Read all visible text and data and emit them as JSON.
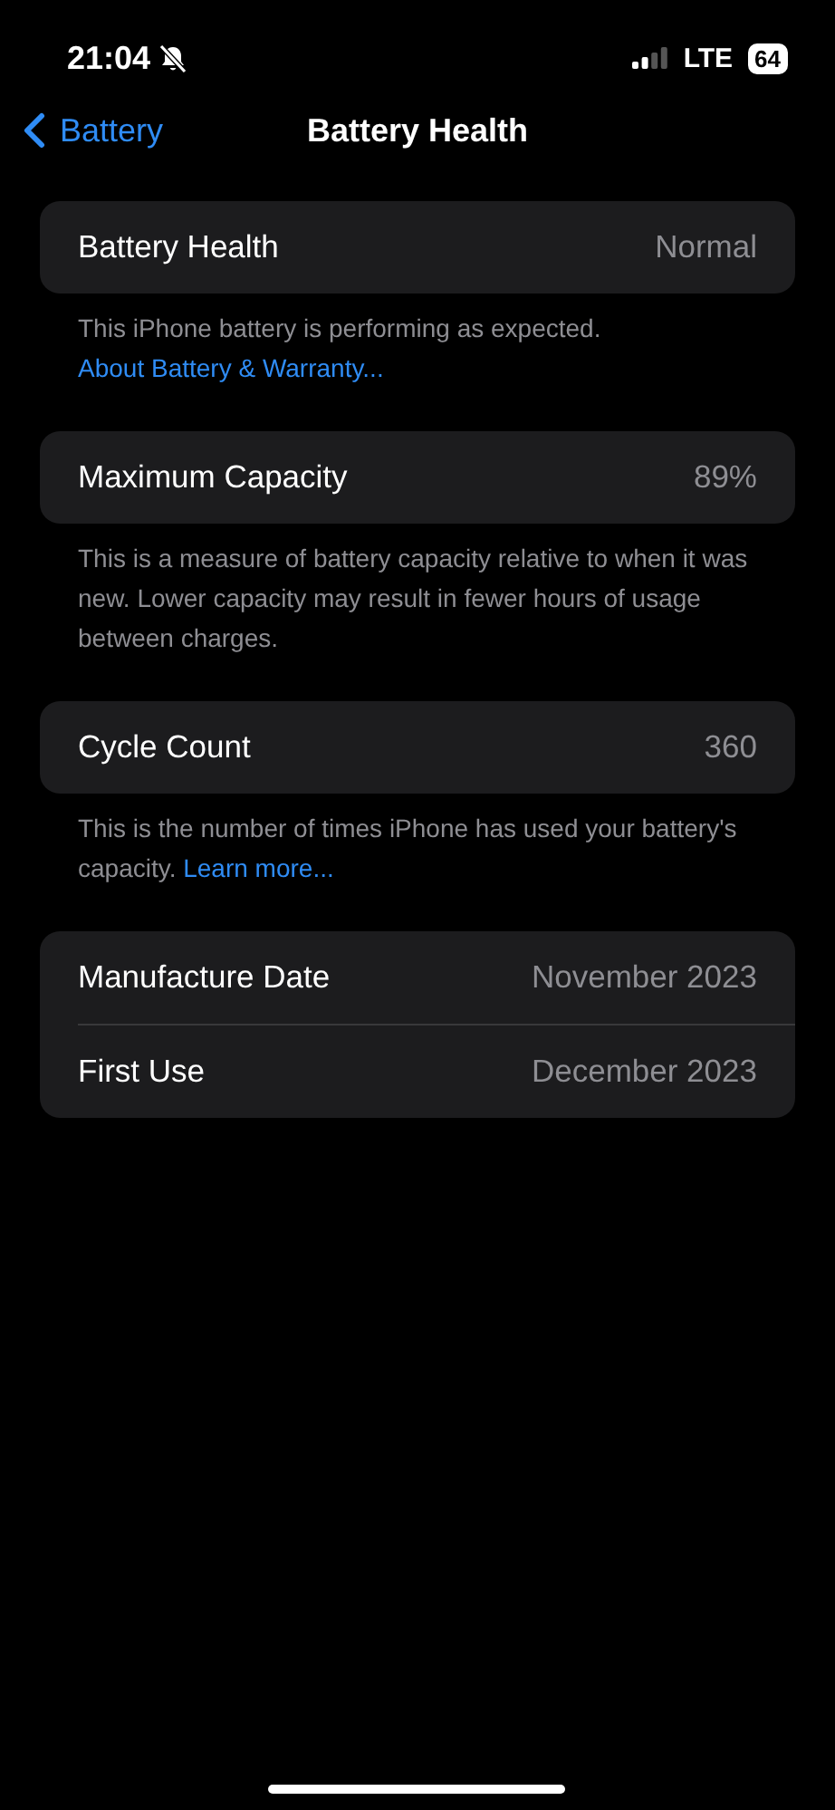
{
  "status_bar": {
    "time": "21:04",
    "network": "LTE",
    "battery": "64"
  },
  "nav": {
    "back": "Battery",
    "title": "Battery Health"
  },
  "sections": [
    {
      "rows": [
        {
          "label": "Battery Health",
          "value": "Normal"
        }
      ],
      "footer": {
        "text": "This iPhone battery is performing as expected.",
        "link": "About Battery & Warranty..."
      }
    },
    {
      "rows": [
        {
          "label": "Maximum Capacity",
          "value": "89%"
        }
      ],
      "footer": {
        "text": "This is a measure of battery capacity relative to when it was new. Lower capacity may result in fewer hours of usage between charges."
      }
    },
    {
      "rows": [
        {
          "label": "Cycle Count",
          "value": "360"
        }
      ],
      "footer": {
        "text": "This is the number of times iPhone has used your battery's capacity.",
        "link": "Learn more..."
      }
    },
    {
      "rows": [
        {
          "label": "Manufacture Date",
          "value": "November 2023"
        },
        {
          "label": "First Use",
          "value": "December 2023"
        }
      ]
    }
  ]
}
